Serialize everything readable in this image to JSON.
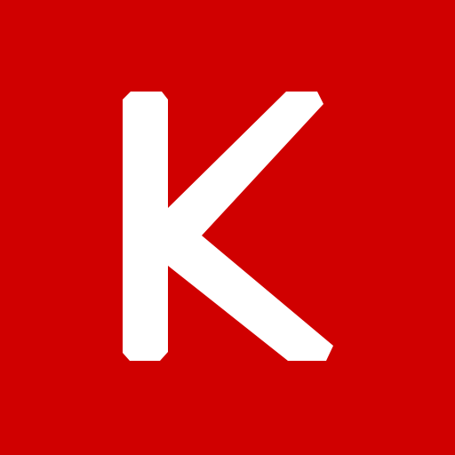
{
  "icon": {
    "name": "keras-logo-icon",
    "letter": "K",
    "colors": {
      "background": "#d00000",
      "glyph": "#ffffff"
    }
  }
}
